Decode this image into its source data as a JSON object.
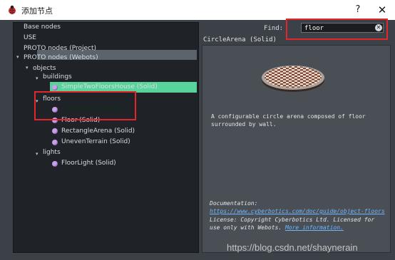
{
  "window": {
    "title": "添加节点",
    "help_label": "?",
    "close_label": "✕"
  },
  "tree": {
    "base_nodes": "Base nodes",
    "use": "USE",
    "proto_project": "PROTO nodes (Project)",
    "proto_webots": "PROTO nodes (Webots)",
    "objects": "objects",
    "buildings": "buildings",
    "simple_house": "SimpleTwoFloorsHouse (Solid)",
    "floors": "floors",
    "circle_arena": "CircleArena (Solid)",
    "floor": "Floor (Solid)",
    "rectangle_arena": "RectangleArena (Solid)",
    "uneven_terrain": "UnevenTerrain (Solid)",
    "lights": "lights",
    "floor_light": "FloorLight (Solid)"
  },
  "search": {
    "label": "Find:",
    "value": "floor"
  },
  "info": {
    "title": "CircleArena (Solid)",
    "description": "A configurable circle arena composed of floor surrounded by wall.",
    "doc_prefix": "Documentation: ",
    "doc_link": "https://www.cyberbotics.com/doc/guide/object-floors",
    "license_text": "License: Copyright Cyberbotics Ltd. Licensed for use only with Webots.",
    "license_link": "More information."
  },
  "watermark": "https://blog.csdn.net/shaynerain",
  "colors": {
    "selected": "#58d39a",
    "highlight": "#5b646c",
    "annotation": "#e2262b",
    "node_dot": "#c7a0ec",
    "link": "#6fb6ff"
  }
}
